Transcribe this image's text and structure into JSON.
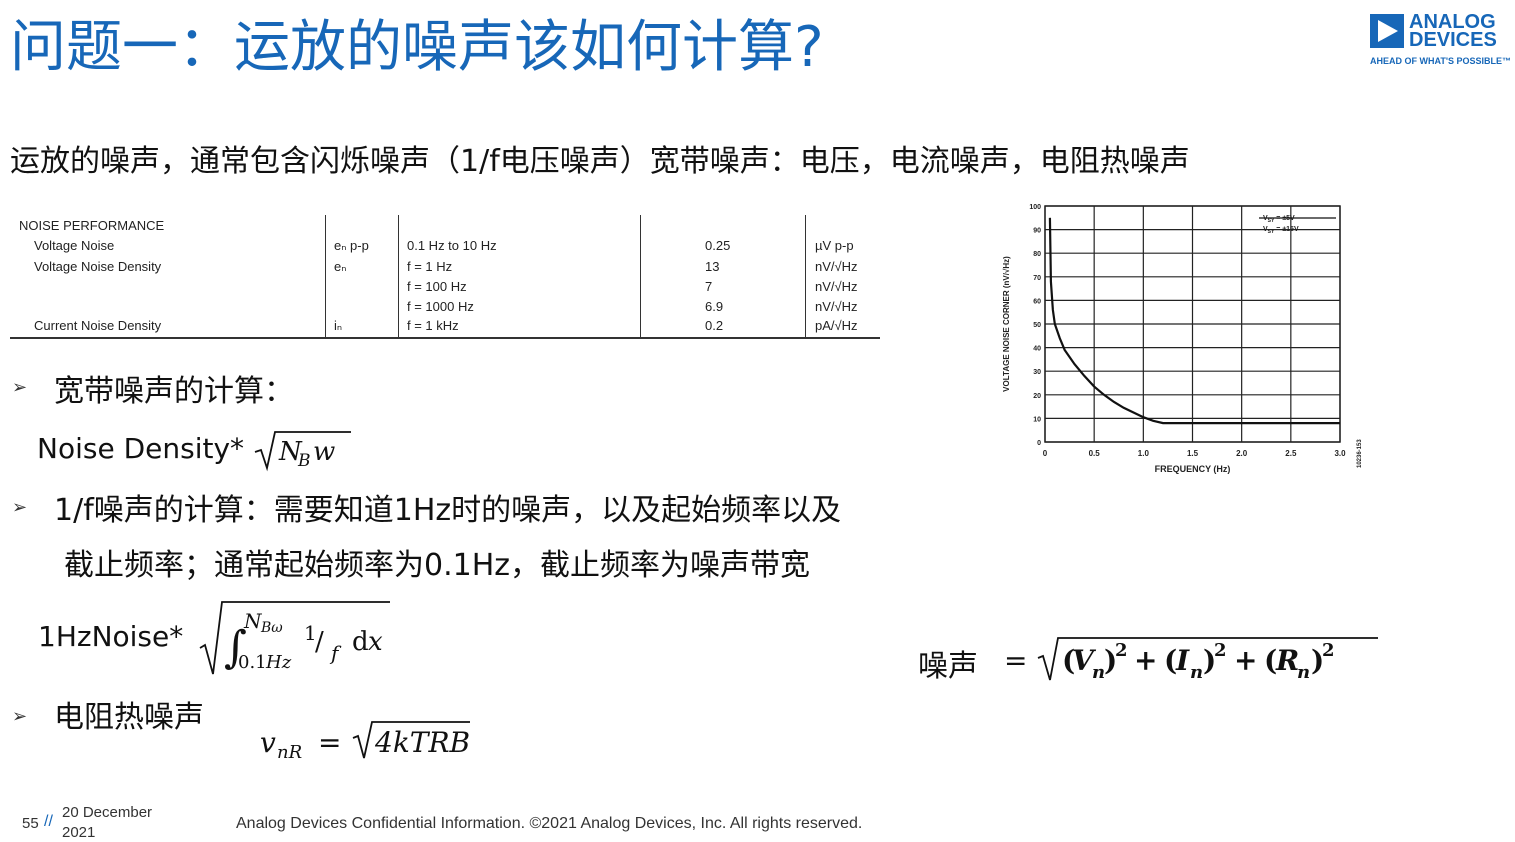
{
  "title": "问题一：运放的噪声该如何计算?",
  "logo": {
    "line1": "ANALOG",
    "line2": "DEVICES",
    "tagline": "AHEAD OF WHAT'S POSSIBLE™"
  },
  "subtitle": "运放的噪声，通常包含闪烁噪声（1/f电压噪声）宽带噪声：电压，电流噪声，电阻热噪声",
  "noise_table": {
    "section": "NOISE PERFORMANCE",
    "rows": [
      {
        "param": "Voltage Noise",
        "symbol": "eₙ p-p",
        "condition": "0.1 Hz to 10 Hz",
        "value": "0.25",
        "unit": "µV p-p"
      },
      {
        "param": "Voltage Noise Density",
        "symbol": "eₙ",
        "condition": "f = 1 Hz",
        "value": "13",
        "unit": "nV/√Hz"
      },
      {
        "param": "",
        "symbol": "",
        "condition": "f = 100 Hz",
        "value": "7",
        "unit": "nV/√Hz"
      },
      {
        "param": "",
        "symbol": "",
        "condition": "f = 1000 Hz",
        "value": "6.9",
        "unit": "nV/√Hz"
      },
      {
        "param": "Current Noise Density",
        "symbol": "iₙ",
        "condition": "f = 1 kHz",
        "value": "0.2",
        "unit": "pA/√Hz"
      }
    ]
  },
  "bullets": {
    "b1": "宽带噪声的计算：",
    "b2_line1": "1/f噪声的计算：需要知道1Hz时的噪声，以及起始频率以及",
    "b2_line2": "截止频率；通常起始频率为0.1Hz，截止频率为噪声带宽",
    "b3": "电阻热噪声"
  },
  "formulas": {
    "f1_prefix": "Noise Density*",
    "f2_prefix": "1HzNoise*",
    "total_label": "噪声"
  },
  "footer": {
    "page": "55",
    "separator": "//",
    "date_line1": "20 December",
    "date_line2": "2021",
    "legal": "Analog Devices Confidential Information. ©2021 Analog Devices, Inc. All rights reserved."
  },
  "chart_data": {
    "type": "line",
    "title": "",
    "xlabel": "FREQUENCY (Hz)",
    "ylabel": "VOLTAGE NOISE CORNER (nV/√Hz)",
    "xlim": [
      0,
      3.0
    ],
    "ylim": [
      0,
      100
    ],
    "x_ticks": [
      "0",
      "0.5",
      "1.0",
      "1.5",
      "2.0",
      "2.5",
      "3.0"
    ],
    "y_ticks": [
      "0",
      "10",
      "20",
      "30",
      "40",
      "50",
      "60",
      "70",
      "80",
      "90",
      "100"
    ],
    "grid": true,
    "legend_lines": [
      "V",
      "V"
    ],
    "legend_placement": "top-right",
    "legend_entries": [
      {
        "sym": "V",
        "sub": "SY",
        "val": "= ±5V"
      },
      {
        "sym": "V",
        "sub": "SY",
        "val": "= ±15V"
      }
    ],
    "side_label": "10236-153",
    "series": [
      {
        "x": [
          0.05,
          0.06,
          0.08,
          0.1,
          0.15,
          0.2,
          0.3,
          0.4,
          0.5,
          0.6,
          0.7,
          0.8,
          0.9,
          1.0,
          1.1,
          1.2,
          1.5,
          2.0,
          2.5,
          3.0
        ],
        "y": [
          95,
          68,
          56,
          50,
          44,
          39,
          33,
          28,
          23.5,
          20,
          17,
          14.5,
          12.5,
          10.5,
          9,
          8,
          8,
          8,
          8,
          8
        ]
      }
    ]
  }
}
